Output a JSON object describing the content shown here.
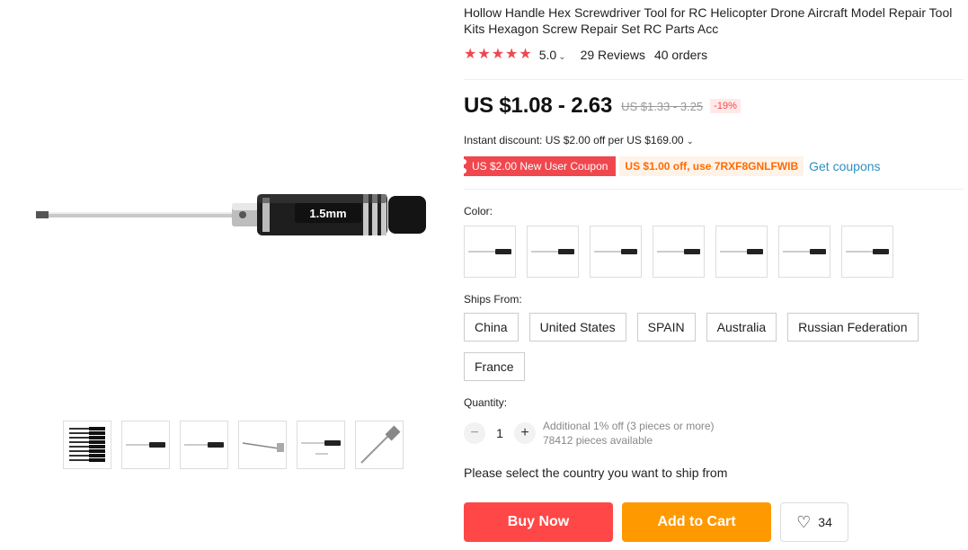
{
  "product": {
    "title": "Hollow Handle Hex Screwdriver Tool for RC Helicopter Drone Aircraft Model Repair Tool Kits Hexagon Screw Repair Set RC Parts Acc",
    "image_label": "1.5mm"
  },
  "rating": {
    "stars": 5,
    "value": "5.0",
    "reviews": "29 Reviews",
    "orders": "40 orders",
    "star_color": "#f0474e"
  },
  "price": {
    "current": "US $1.08 - 2.63",
    "original": "US $1.33 - 3.25",
    "discount": "-19%"
  },
  "instant_discount": "Instant discount: US $2.00 off per US $169.00",
  "coupons": {
    "new_user": "US $2.00 New User Coupon",
    "code_offer": "US $1.00 off, use 7RXF8GNLFWIB",
    "get_link": "Get coupons"
  },
  "color": {
    "label": "Color:",
    "options": [
      "variant-1",
      "variant-2",
      "variant-3",
      "variant-4",
      "variant-5",
      "variant-6",
      "variant-7"
    ]
  },
  "ships_from": {
    "label": "Ships From:",
    "options": [
      "China",
      "United States",
      "SPAIN",
      "Australia",
      "Russian Federation",
      "France"
    ]
  },
  "quantity": {
    "label": "Quantity:",
    "value": "1",
    "offer": "Additional 1% off (3 pieces or more)",
    "available": "78412 pieces available"
  },
  "ship_message": "Please select the country you want to ship from",
  "buttons": {
    "buy_now": "Buy Now",
    "add_to_cart": "Add to Cart",
    "wishlist_count": "34"
  },
  "colors": {
    "buy": "#ff4747",
    "cart": "#ff9900",
    "coupon_red": "#f0474e",
    "coupon_orange": "#ff6a00",
    "link": "#2e8fc1"
  }
}
